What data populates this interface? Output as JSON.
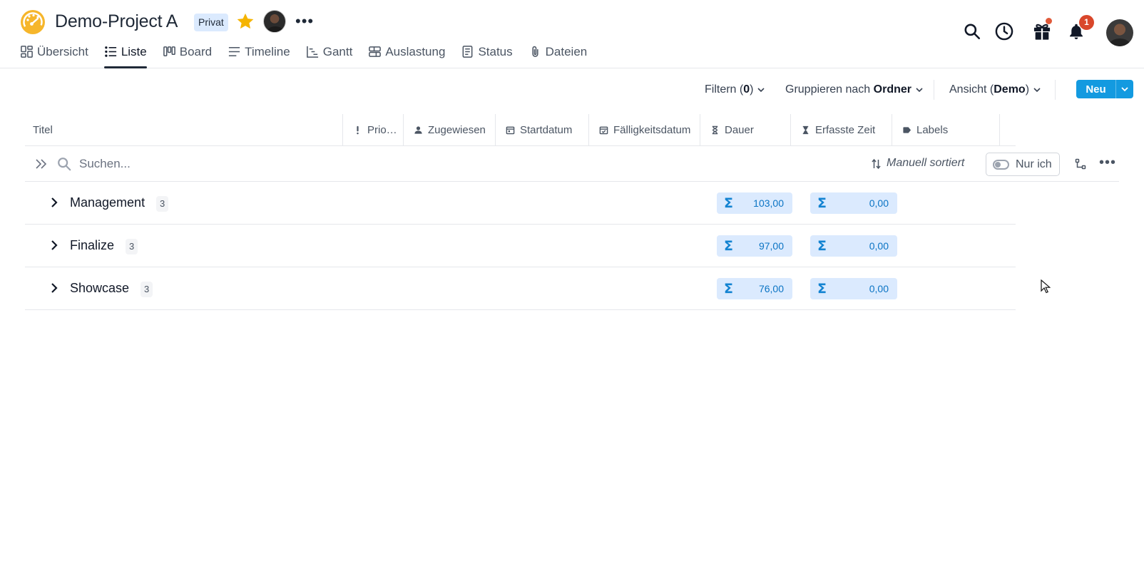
{
  "project": {
    "title": "Demo-Project A",
    "badge": "Privat"
  },
  "tabs": [
    {
      "label": "Übersicht",
      "icon": "dashboard-icon",
      "active": false
    },
    {
      "label": "Liste",
      "icon": "list-icon",
      "active": true
    },
    {
      "label": "Board",
      "icon": "board-icon",
      "active": false
    },
    {
      "label": "Timeline",
      "icon": "timeline-icon",
      "active": false
    },
    {
      "label": "Gantt",
      "icon": "gantt-icon",
      "active": false
    },
    {
      "label": "Auslastung",
      "icon": "workload-icon",
      "active": false
    },
    {
      "label": "Status",
      "icon": "status-icon",
      "active": false
    },
    {
      "label": "Dateien",
      "icon": "paperclip-icon",
      "active": false
    }
  ],
  "header_icons": {
    "notifications_count": "1"
  },
  "toolbar": {
    "filter_prefix": "Filtern (",
    "filter_count": "0",
    "filter_suffix": ")",
    "group_prefix": "Gruppieren nach ",
    "group_value": "Ordner",
    "view_prefix": "Ansicht (",
    "view_value": "Demo",
    "view_suffix": ")",
    "new_label": "Neu"
  },
  "columns": [
    {
      "label": "Titel",
      "icon": ""
    },
    {
      "label": "Prio…",
      "icon": "exclamation-icon"
    },
    {
      "label": "Zugewiesen",
      "icon": "person-icon"
    },
    {
      "label": "Startdatum",
      "icon": "calendar-icon"
    },
    {
      "label": "Fälligkeitsdatum",
      "icon": "calendar-check-icon"
    },
    {
      "label": "Dauer",
      "icon": "hourglass-icon"
    },
    {
      "label": "Erfasste Zeit",
      "icon": "hourglass-filled-icon"
    },
    {
      "label": "Labels",
      "icon": "label-icon"
    }
  ],
  "search": {
    "placeholder": "Suchen...",
    "sort_label": "Manuell sortiert",
    "toggle_label": "Nur ich"
  },
  "groups": [
    {
      "name": "Management",
      "count": "3",
      "dauer_sum": "103,00",
      "erfasst_sum": "0,00"
    },
    {
      "name": "Finalize",
      "count": "3",
      "dauer_sum": "97,00",
      "erfasst_sum": "0,00"
    },
    {
      "name": "Showcase",
      "count": "3",
      "dauer_sum": "76,00",
      "erfasst_sum": "0,00"
    }
  ],
  "colors": {
    "accent": "#139ae0",
    "star": "#f5b400",
    "logo": "#f6b62b",
    "sum_pill_bg": "#dbeafe",
    "notification": "#d9472b"
  }
}
